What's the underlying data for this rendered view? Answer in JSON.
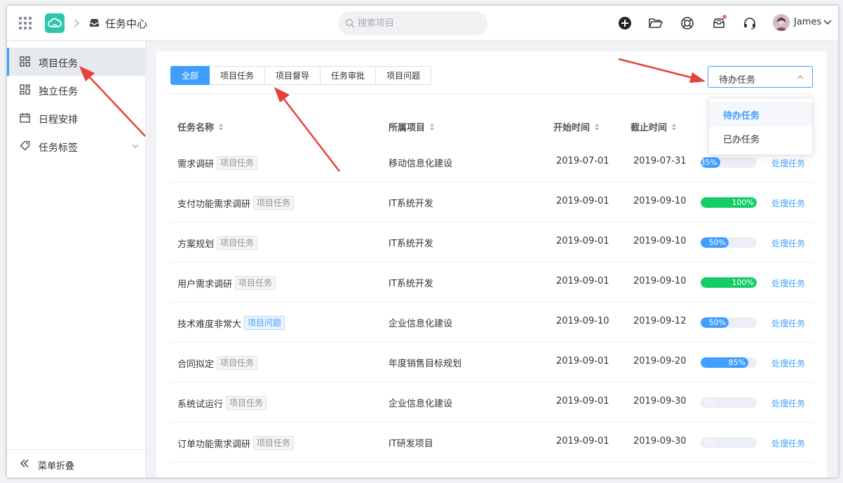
{
  "header": {
    "page_title": "任务中心",
    "search_placeholder": "搜索项目",
    "user_name": "James"
  },
  "sidebar": {
    "items": [
      {
        "label": "项目任务",
        "icon": "grid-icon",
        "active": true
      },
      {
        "label": "独立任务",
        "icon": "layout-icon",
        "active": false
      },
      {
        "label": "日程安排",
        "icon": "calendar-icon",
        "active": false
      },
      {
        "label": "任务标签",
        "icon": "tag-icon",
        "active": false
      }
    ],
    "collapse_label": "菜单折叠"
  },
  "tabs": [
    "全部",
    "项目任务",
    "项目督导",
    "任务审批",
    "项目问题"
  ],
  "filter": {
    "selected": "待办任务",
    "options": [
      "待办任务",
      "已办任务"
    ]
  },
  "table": {
    "columns": [
      "任务名称",
      "所属项目",
      "开始时间",
      "截止时间"
    ],
    "action_label": "处理任务",
    "rows": [
      {
        "name": "需求调研",
        "tag": "项目任务",
        "project": "移动信息化建设",
        "start": "2019-07-01",
        "end": "2019-07-31",
        "progress": 35,
        "progress_label": "35%"
      },
      {
        "name": "支付功能需求调研",
        "tag": "项目任务",
        "project": "IT系统开发",
        "start": "2019-09-01",
        "end": "2019-09-10",
        "progress": 100,
        "progress_label": "100%"
      },
      {
        "name": "方案规划",
        "tag": "项目任务",
        "project": "IT系统开发",
        "start": "2019-09-01",
        "end": "2019-09-10",
        "progress": 50,
        "progress_label": "50%"
      },
      {
        "name": "用户需求调研",
        "tag": "项目任务",
        "project": "IT系统开发",
        "start": "2019-09-01",
        "end": "2019-09-10",
        "progress": 100,
        "progress_label": "100%"
      },
      {
        "name": "技术难度非常大",
        "tag": "项目问题",
        "project": "企业信息化建设",
        "start": "2019-09-10",
        "end": "2019-09-12",
        "progress": 50,
        "progress_label": "50%"
      },
      {
        "name": "合同拟定",
        "tag": "项目任务",
        "project": "年度销售目标规划",
        "start": "2019-09-01",
        "end": "2019-09-20",
        "progress": 85,
        "progress_label": "85%"
      },
      {
        "name": "系统试运行",
        "tag": "项目任务",
        "project": "企业信息化建设",
        "start": "2019-09-01",
        "end": "2019-09-30",
        "progress": 0,
        "progress_label": "0%"
      },
      {
        "name": "订单功能需求调研",
        "tag": "项目任务",
        "project": "IT研发项目",
        "start": "2019-09-01",
        "end": "2019-09-30",
        "progress": 0,
        "progress_label": "0%"
      }
    ]
  },
  "colors": {
    "primary": "#409eff",
    "success": "#13ce66",
    "arrow": "#e8413a",
    "logo": "#2fc5a8"
  }
}
